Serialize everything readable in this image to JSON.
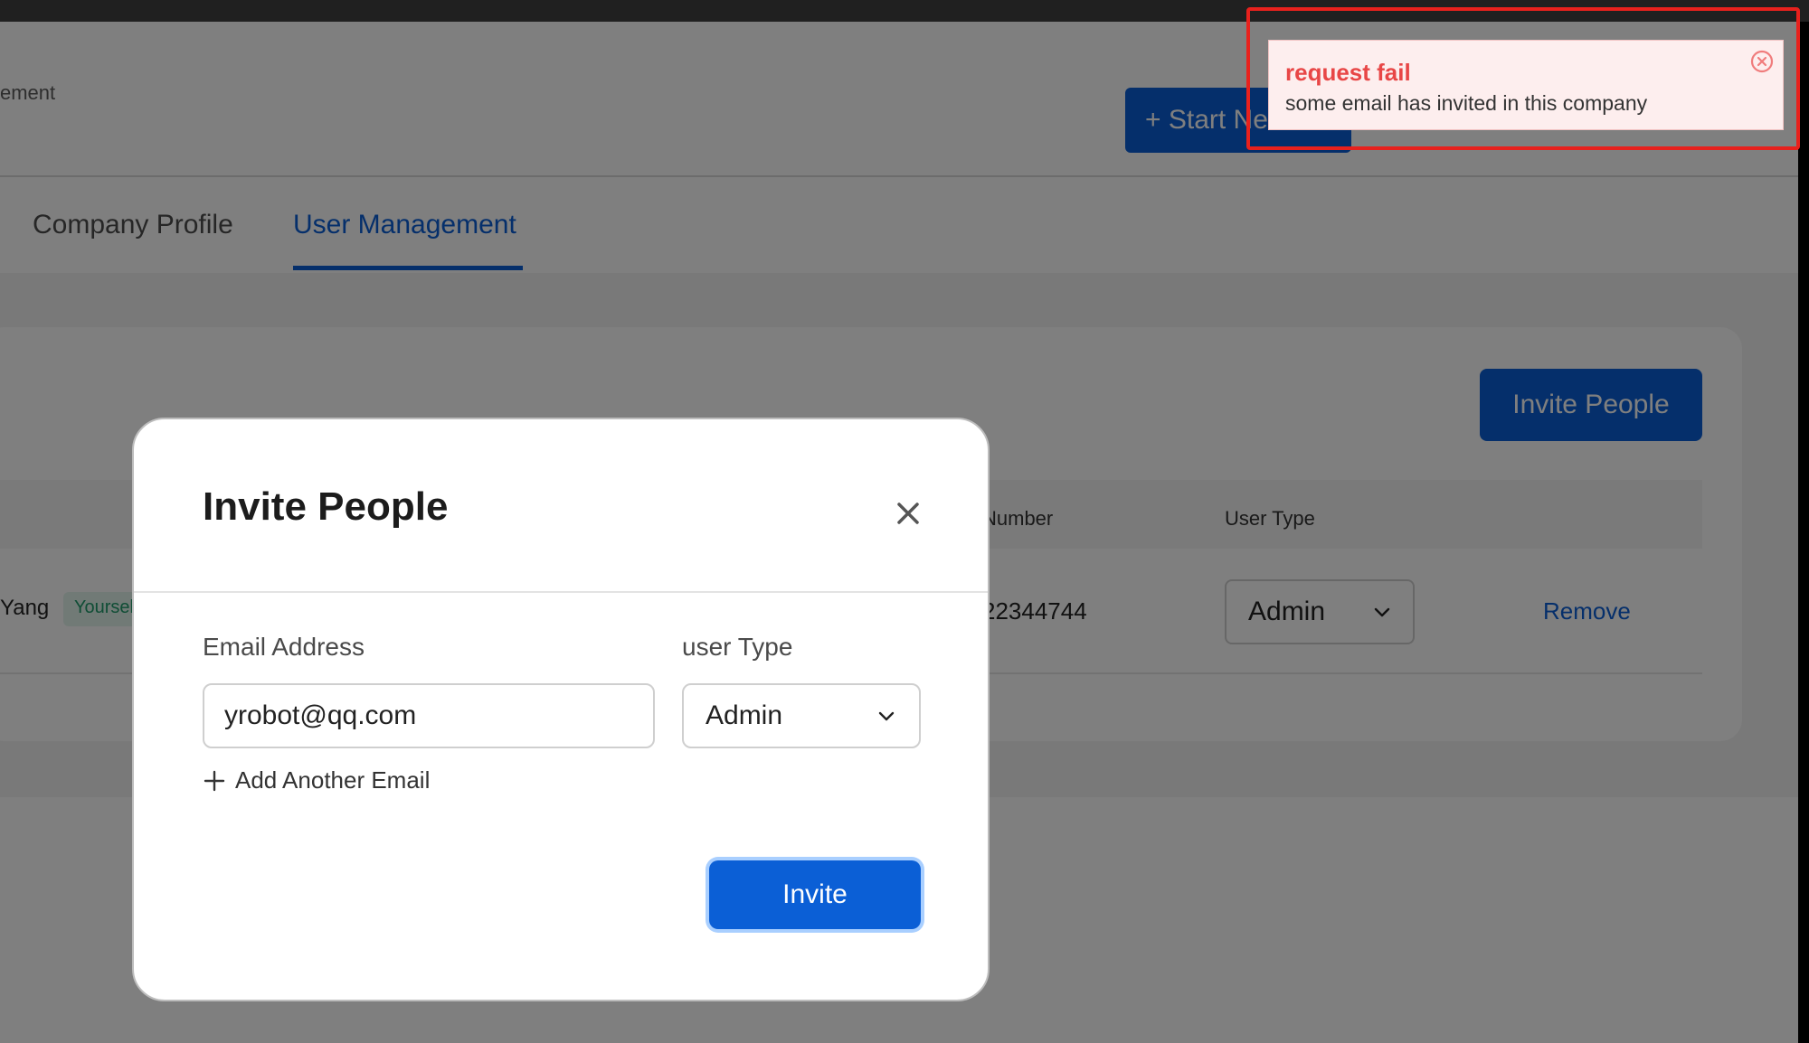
{
  "header": {
    "crumb": "ement",
    "start_button": "+ Start Ne"
  },
  "tabs": [
    {
      "label": "Company Profile",
      "active": false
    },
    {
      "label": "User Management",
      "active": true
    }
  ],
  "page": {
    "invite_button": "Invite People",
    "table": {
      "headers": {
        "number": "Number",
        "user_type": "User Type"
      },
      "rows": [
        {
          "name": "Yang",
          "badge": "Yourself",
          "number": "22344744",
          "user_type": "Admin",
          "action": "Remove"
        }
      ]
    }
  },
  "modal": {
    "title": "Invite People",
    "email_label": "Email Address",
    "email_value": "yrobot@qq.com",
    "type_label": "user Type",
    "type_value": "Admin",
    "add_email": "Add Another Email",
    "submit": "Invite"
  },
  "toast": {
    "title": "request fail",
    "message": "some email has invited in this company"
  },
  "colors": {
    "accent": "#0b5fd6",
    "error": "#e84646",
    "highlight": "#e8211d"
  },
  "icons": {
    "close": "close-icon",
    "chevron": "chevron-down-icon",
    "plus": "plus-icon",
    "toast_close": "close-circle-icon"
  }
}
